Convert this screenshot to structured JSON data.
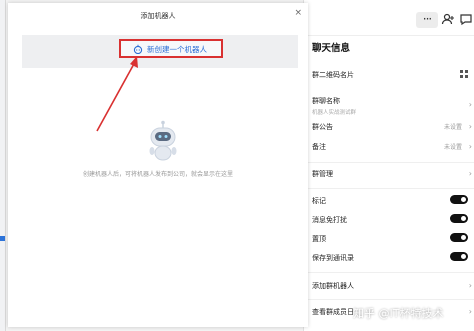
{
  "dialog": {
    "title": "添加机器人",
    "close_glyph": "×",
    "create_label": "新创建一个机器人",
    "empty_tip": "创建机器人后，可将机器人发布到公司，就会显示在这里"
  },
  "panel": {
    "more_glyph": "···",
    "title": "聊天信息",
    "rows": [
      {
        "label": "群二维码名片"
      },
      {
        "label": "群聊名称",
        "sub": "机器人实战测试群"
      },
      {
        "label": "群公告",
        "right": "未设置"
      },
      {
        "label": "备注",
        "right": "未设置"
      },
      {
        "label": "群管理"
      },
      {
        "label": "标记"
      },
      {
        "label": "消息免打扰"
      },
      {
        "label": "置顶"
      },
      {
        "label": "保存到通讯录"
      },
      {
        "label": "添加群机器人"
      },
      {
        "label": "查看群成员日"
      }
    ]
  },
  "watermark": "知乎 @IT杯特技术",
  "colors": {
    "accent": "#2d6fd6",
    "highlight": "#d93131",
    "toggle": "#111111"
  }
}
